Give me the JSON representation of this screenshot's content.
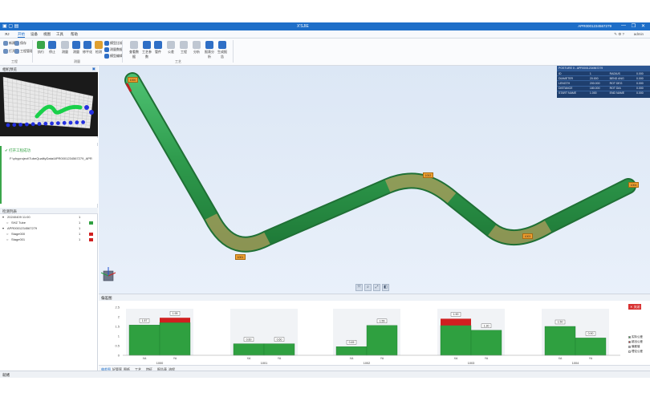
{
  "window": {
    "title": "X'SJIE",
    "user": "APR0001234567279",
    "user_right": "admin",
    "controls": [
      "—",
      "❐",
      "✕"
    ]
  },
  "menu": {
    "tabs": [
      "ЯJ",
      "开始",
      "设备",
      "视图",
      "工具",
      "帮助"
    ],
    "active": 1
  },
  "ribbon": {
    "buttons": [
      {
        "name": "new-button",
        "label": "新建",
        "color": "#6b8fbf"
      },
      {
        "name": "open-button",
        "label": "打开",
        "color": "#6b8fbf"
      },
      {
        "name": "save-button",
        "label": "保存",
        "color": "#6b8fbf"
      },
      {
        "name": "process-manage-button",
        "label": "工程管理",
        "color": "#6b8fbf"
      },
      {
        "name": "run-button",
        "label": "执行",
        "color": "#3aa64a"
      },
      {
        "name": "stop-button",
        "label": "停止",
        "color": "#2f6fc6"
      },
      {
        "name": "measure-button",
        "label": "测量",
        "color": "#bfc7d2"
      },
      {
        "name": "fit-button",
        "label": "测量",
        "color": "#2f6fc6"
      },
      {
        "name": "smooth-button",
        "label": "修平化",
        "color": "#2f6fc6"
      },
      {
        "name": "check-button",
        "label": "检测",
        "color": "#e0a030"
      },
      {
        "name": "model-compare-button",
        "label": "模型比较",
        "color": "#2f6fc6"
      },
      {
        "name": "measure-data-button",
        "label": "测量数据",
        "color": "#2f6fc6"
      },
      {
        "name": "model-edit-button",
        "label": "模型编辑",
        "color": "#2f6fc6"
      },
      {
        "name": "view-data-button",
        "label": "查看数据",
        "color": "#bfc7d2"
      },
      {
        "name": "process-params-button",
        "label": "工艺参数",
        "color": "#2f6fc6"
      },
      {
        "name": "tube-button",
        "label": "管件",
        "color": "#2f6fc6"
      },
      {
        "name": "tolerance-button",
        "label": "公差",
        "color": "#bfc7d2"
      },
      {
        "name": "project-button",
        "label": "工程",
        "color": "#bfc7d2"
      },
      {
        "name": "analyze-button",
        "label": "分析",
        "color": "#bfc7d2"
      },
      {
        "name": "report-button",
        "label": "报表分析",
        "color": "#2f6fc6"
      },
      {
        "name": "generate-report-button",
        "label": "生成报告",
        "color": "#2f6fc6"
      }
    ],
    "groups": [
      "工程",
      "测量",
      "工艺"
    ]
  },
  "left": {
    "preview_title": "相机预览",
    "message_title": "打开工程成功",
    "message_path": "F:\\phyproject\\TubeQualityData\\APR0001234567279_APR",
    "tree_title": "检测列表",
    "tree": [
      {
        "indent": 0,
        "label": "20240409 11:00",
        "count": "1",
        "flag": ""
      },
      {
        "indent": 1,
        "label": "SHZ Tube",
        "count": "1",
        "flag": "#2fa040"
      },
      {
        "indent": 0,
        "label": "APR0001234567279",
        "count": "1",
        "flag": ""
      },
      {
        "indent": 1,
        "label": "Stage000",
        "count": "1",
        "flag": "#d02020"
      },
      {
        "indent": 1,
        "label": "Stage001",
        "count": "1",
        "flag": "#d02020"
      }
    ]
  },
  "info": {
    "title": "POSTURE 0 - APR0001234567279",
    "rows": [
      [
        "ID",
        "1",
        "RADIUS",
        "0.000"
      ],
      [
        "DIAMETER",
        "20.000",
        "BEND ANG",
        "0.000"
      ],
      [
        "LENGTH",
        "200.000",
        "ROT DEG",
        "0.000"
      ],
      [
        "DISTANCE",
        "180.000",
        "ROT DIA",
        "0.000"
      ],
      [
        "START NAME",
        "1.000",
        "END NAME",
        "0.000"
      ]
    ]
  },
  "viewport_labels": [
    "1000",
    "1001",
    "1002",
    "1003",
    "1004"
  ],
  "view_tools": [
    "⤧",
    "⌕",
    "⤢",
    "◧"
  ],
  "chart_panel": {
    "title": "偏差图",
    "close_label": "关闭",
    "legend": [
      {
        "label": "实际公差",
        "color": "#2fa040"
      },
      {
        "label": "超出公差",
        "color": "#d02020"
      },
      {
        "label": "偏差值",
        "color": "#a0a8b4"
      },
      {
        "label": "理论公差",
        "color": "#e9ecf0"
      }
    ],
    "tabs": [
      "偏差图",
      "好管率",
      "图纸",
      "工艺",
      "特征",
      "报告表",
      "流程"
    ]
  },
  "chart_data": {
    "type": "bar",
    "y_ticks": [
      "2.5",
      "2",
      "1.5",
      "1",
      "0.5",
      "0"
    ],
    "ylim": [
      0,
      2.5
    ],
    "groups": [
      {
        "label": "1000",
        "bars": [
          {
            "name": "XA",
            "value": 1.57,
            "over": 0,
            "label": "1.57"
          },
          {
            "name": "YA",
            "value": 1.95,
            "over": 0.25,
            "label": "1.95"
          }
        ]
      },
      {
        "label": "1001",
        "bars": [
          {
            "name": "XA",
            "value": 0.6,
            "over": 0,
            "label": "0.60"
          },
          {
            "name": "YA",
            "value": 0.6,
            "over": 0,
            "label": "0.60"
          }
        ]
      },
      {
        "label": "1002",
        "bars": [
          {
            "name": "XA",
            "value": 0.45,
            "over": 0,
            "label": "0.45"
          },
          {
            "name": "YA",
            "value": 1.55,
            "over": 0,
            "label": "1.55"
          }
        ]
      },
      {
        "label": "1003",
        "bars": [
          {
            "name": "XA",
            "value": 1.9,
            "over": 0.35,
            "label": "1.90"
          },
          {
            "name": "YA",
            "value": 1.3,
            "over": 0,
            "label": "1.30"
          }
        ]
      },
      {
        "label": "1004",
        "bars": [
          {
            "name": "XA",
            "value": 1.5,
            "over": 0,
            "label": "1.50"
          },
          {
            "name": "YA",
            "value": 0.9,
            "over": 0,
            "label": "0.90"
          }
        ]
      }
    ]
  },
  "status": {
    "text": "就绪"
  }
}
